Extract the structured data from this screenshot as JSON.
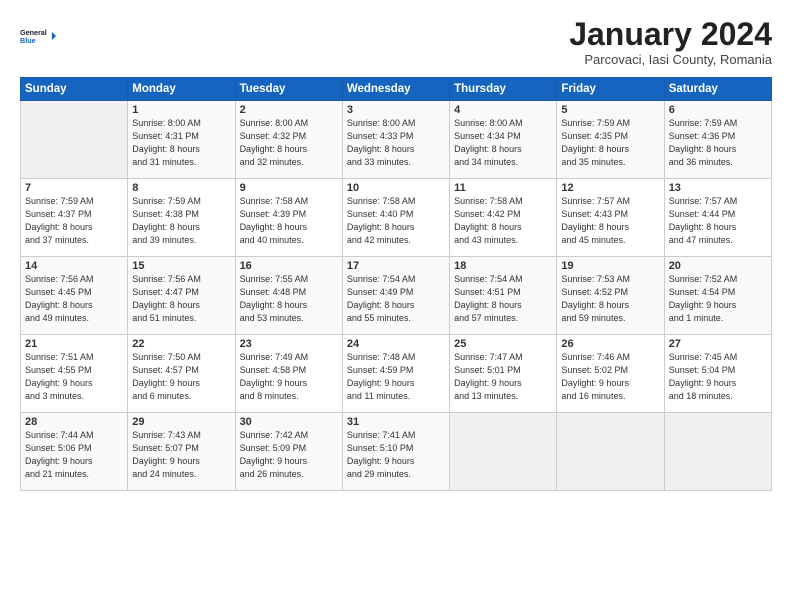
{
  "header": {
    "logo_line1": "General",
    "logo_line2": "Blue",
    "title": "January 2024",
    "location": "Parcovaci, Iasi County, Romania"
  },
  "weekdays": [
    "Sunday",
    "Monday",
    "Tuesday",
    "Wednesday",
    "Thursday",
    "Friday",
    "Saturday"
  ],
  "weeks": [
    [
      {
        "day": "",
        "info": ""
      },
      {
        "day": "1",
        "info": "Sunrise: 8:00 AM\nSunset: 4:31 PM\nDaylight: 8 hours\nand 31 minutes."
      },
      {
        "day": "2",
        "info": "Sunrise: 8:00 AM\nSunset: 4:32 PM\nDaylight: 8 hours\nand 32 minutes."
      },
      {
        "day": "3",
        "info": "Sunrise: 8:00 AM\nSunset: 4:33 PM\nDaylight: 8 hours\nand 33 minutes."
      },
      {
        "day": "4",
        "info": "Sunrise: 8:00 AM\nSunset: 4:34 PM\nDaylight: 8 hours\nand 34 minutes."
      },
      {
        "day": "5",
        "info": "Sunrise: 7:59 AM\nSunset: 4:35 PM\nDaylight: 8 hours\nand 35 minutes."
      },
      {
        "day": "6",
        "info": "Sunrise: 7:59 AM\nSunset: 4:36 PM\nDaylight: 8 hours\nand 36 minutes."
      }
    ],
    [
      {
        "day": "7",
        "info": "Sunrise: 7:59 AM\nSunset: 4:37 PM\nDaylight: 8 hours\nand 37 minutes."
      },
      {
        "day": "8",
        "info": "Sunrise: 7:59 AM\nSunset: 4:38 PM\nDaylight: 8 hours\nand 39 minutes."
      },
      {
        "day": "9",
        "info": "Sunrise: 7:58 AM\nSunset: 4:39 PM\nDaylight: 8 hours\nand 40 minutes."
      },
      {
        "day": "10",
        "info": "Sunrise: 7:58 AM\nSunset: 4:40 PM\nDaylight: 8 hours\nand 42 minutes."
      },
      {
        "day": "11",
        "info": "Sunrise: 7:58 AM\nSunset: 4:42 PM\nDaylight: 8 hours\nand 43 minutes."
      },
      {
        "day": "12",
        "info": "Sunrise: 7:57 AM\nSunset: 4:43 PM\nDaylight: 8 hours\nand 45 minutes."
      },
      {
        "day": "13",
        "info": "Sunrise: 7:57 AM\nSunset: 4:44 PM\nDaylight: 8 hours\nand 47 minutes."
      }
    ],
    [
      {
        "day": "14",
        "info": "Sunrise: 7:56 AM\nSunset: 4:45 PM\nDaylight: 8 hours\nand 49 minutes."
      },
      {
        "day": "15",
        "info": "Sunrise: 7:56 AM\nSunset: 4:47 PM\nDaylight: 8 hours\nand 51 minutes."
      },
      {
        "day": "16",
        "info": "Sunrise: 7:55 AM\nSunset: 4:48 PM\nDaylight: 8 hours\nand 53 minutes."
      },
      {
        "day": "17",
        "info": "Sunrise: 7:54 AM\nSunset: 4:49 PM\nDaylight: 8 hours\nand 55 minutes."
      },
      {
        "day": "18",
        "info": "Sunrise: 7:54 AM\nSunset: 4:51 PM\nDaylight: 8 hours\nand 57 minutes."
      },
      {
        "day": "19",
        "info": "Sunrise: 7:53 AM\nSunset: 4:52 PM\nDaylight: 8 hours\nand 59 minutes."
      },
      {
        "day": "20",
        "info": "Sunrise: 7:52 AM\nSunset: 4:54 PM\nDaylight: 9 hours\nand 1 minute."
      }
    ],
    [
      {
        "day": "21",
        "info": "Sunrise: 7:51 AM\nSunset: 4:55 PM\nDaylight: 9 hours\nand 3 minutes."
      },
      {
        "day": "22",
        "info": "Sunrise: 7:50 AM\nSunset: 4:57 PM\nDaylight: 9 hours\nand 6 minutes."
      },
      {
        "day": "23",
        "info": "Sunrise: 7:49 AM\nSunset: 4:58 PM\nDaylight: 9 hours\nand 8 minutes."
      },
      {
        "day": "24",
        "info": "Sunrise: 7:48 AM\nSunset: 4:59 PM\nDaylight: 9 hours\nand 11 minutes."
      },
      {
        "day": "25",
        "info": "Sunrise: 7:47 AM\nSunset: 5:01 PM\nDaylight: 9 hours\nand 13 minutes."
      },
      {
        "day": "26",
        "info": "Sunrise: 7:46 AM\nSunset: 5:02 PM\nDaylight: 9 hours\nand 16 minutes."
      },
      {
        "day": "27",
        "info": "Sunrise: 7:45 AM\nSunset: 5:04 PM\nDaylight: 9 hours\nand 18 minutes."
      }
    ],
    [
      {
        "day": "28",
        "info": "Sunrise: 7:44 AM\nSunset: 5:06 PM\nDaylight: 9 hours\nand 21 minutes."
      },
      {
        "day": "29",
        "info": "Sunrise: 7:43 AM\nSunset: 5:07 PM\nDaylight: 9 hours\nand 24 minutes."
      },
      {
        "day": "30",
        "info": "Sunrise: 7:42 AM\nSunset: 5:09 PM\nDaylight: 9 hours\nand 26 minutes."
      },
      {
        "day": "31",
        "info": "Sunrise: 7:41 AM\nSunset: 5:10 PM\nDaylight: 9 hours\nand 29 minutes."
      },
      {
        "day": "",
        "info": ""
      },
      {
        "day": "",
        "info": ""
      },
      {
        "day": "",
        "info": ""
      }
    ]
  ]
}
